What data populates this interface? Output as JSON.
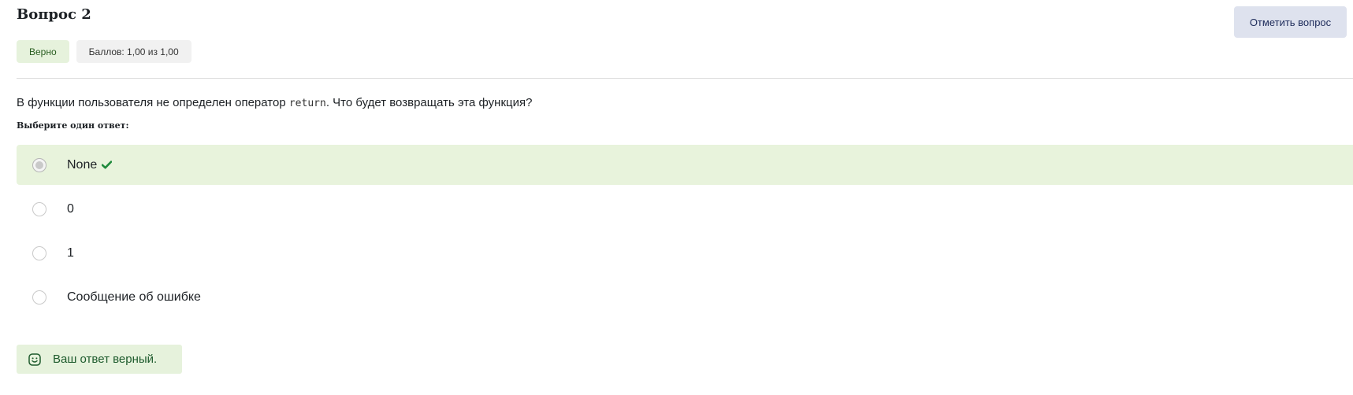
{
  "question": {
    "title": "Вопрос 2",
    "flag_label": "Отметить вопрос",
    "state": "Верно",
    "grade": "Баллов: 1,00 из 1,00",
    "text_before": "В функции пользователя не определен оператор ",
    "code": "return",
    "text_after": ". Что будет возвращать эта функция?",
    "prompt": "Выберите один ответ:"
  },
  "answers": [
    {
      "label": "None",
      "selected": true,
      "correct": true
    },
    {
      "label": "0",
      "selected": false,
      "correct": false
    },
    {
      "label": "1",
      "selected": false,
      "correct": false
    },
    {
      "label": "Сообщение об ошибке",
      "selected": false,
      "correct": false
    }
  ],
  "feedback": {
    "text": "Ваш ответ верный."
  },
  "colors": {
    "correct_bg": "#e8f3dc",
    "check_green": "#1f8a3c",
    "flag_bg": "#dee2ee"
  },
  "icons": {
    "check": "check-icon",
    "smile": "smile-icon",
    "flag": "flag-button"
  }
}
